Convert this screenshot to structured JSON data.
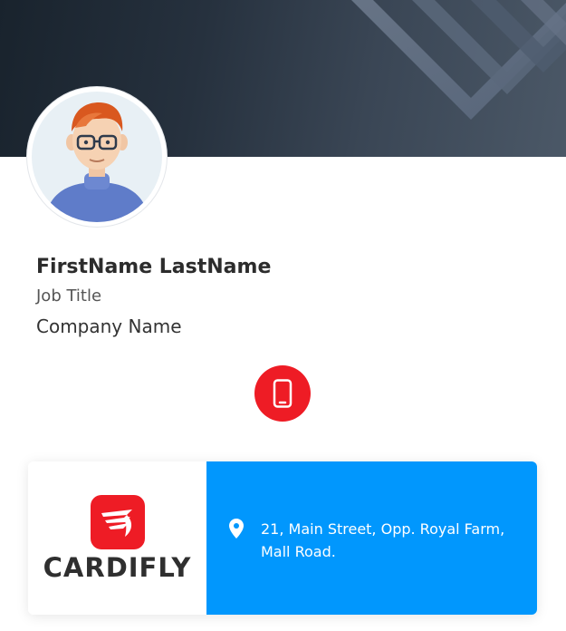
{
  "profile": {
    "name": "FirstName LastName",
    "job_title": "Job Title",
    "company": "Company Name",
    "avatar_icon": "avatar-illustration"
  },
  "actions": {
    "phone_icon": "phone-icon",
    "phone_color": "#ee1c25"
  },
  "company_card": {
    "logo_text": "CARDIFLY",
    "logo_color": "#ee1c25",
    "address_icon": "location-pin-icon",
    "address_line1": "21, Main Street, Opp. Royal Farm,",
    "address_line2": "Mall Road.",
    "panel_color": "#0197fd"
  },
  "theme": {
    "banner_color": "#26313e"
  }
}
